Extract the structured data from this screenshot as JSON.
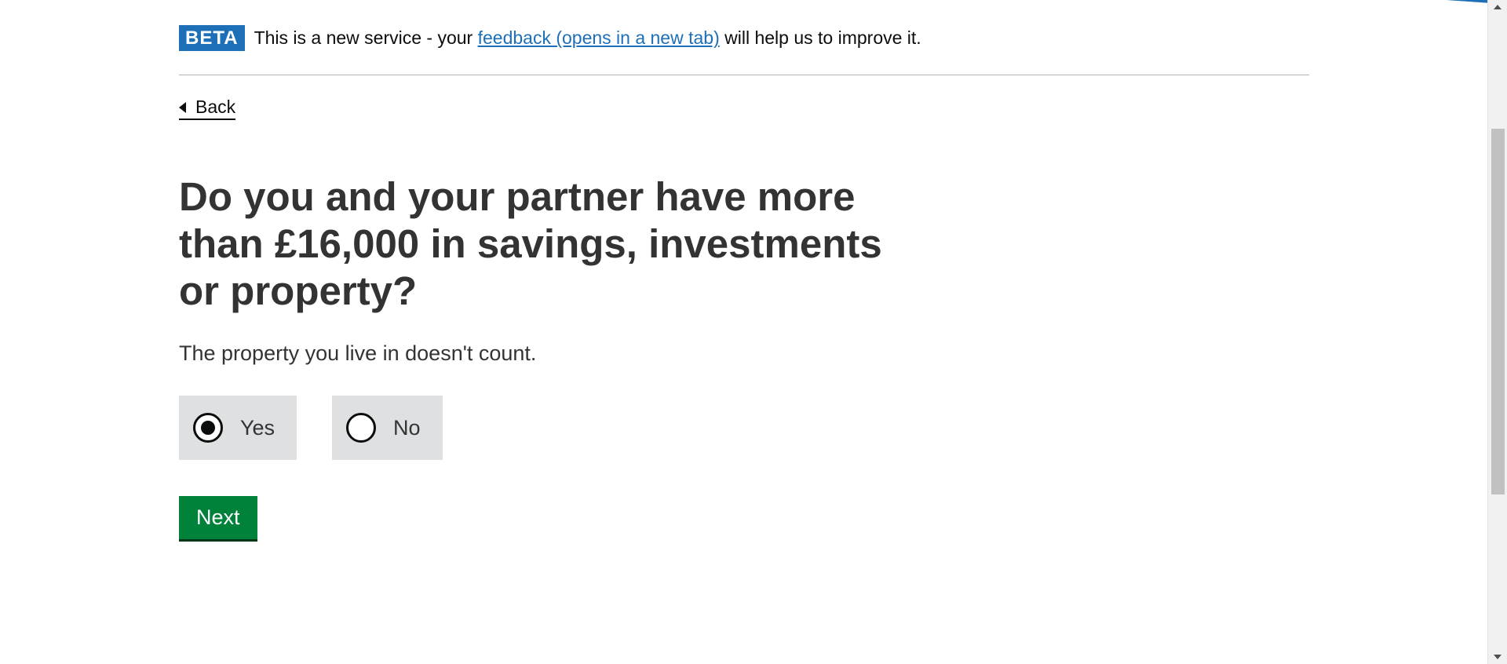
{
  "phase_banner": {
    "tag": "BETA",
    "text_before": "This is a new service - your ",
    "link_text": "feedback (opens in a new tab)",
    "text_after": " will help us to improve it."
  },
  "back_link": {
    "label": "Back"
  },
  "question": {
    "heading": "Do you and your partner have more than £16,000 in savings, investments or property?",
    "hint": "The property you live in doesn't count."
  },
  "radios": [
    {
      "label": "Yes",
      "checked": true
    },
    {
      "label": "No",
      "checked": false
    }
  ],
  "next_button": {
    "label": "Next"
  },
  "colors": {
    "brand_blue": "#1d70b8",
    "button_green": "#00823b",
    "radio_bg": "#dee0e2"
  }
}
